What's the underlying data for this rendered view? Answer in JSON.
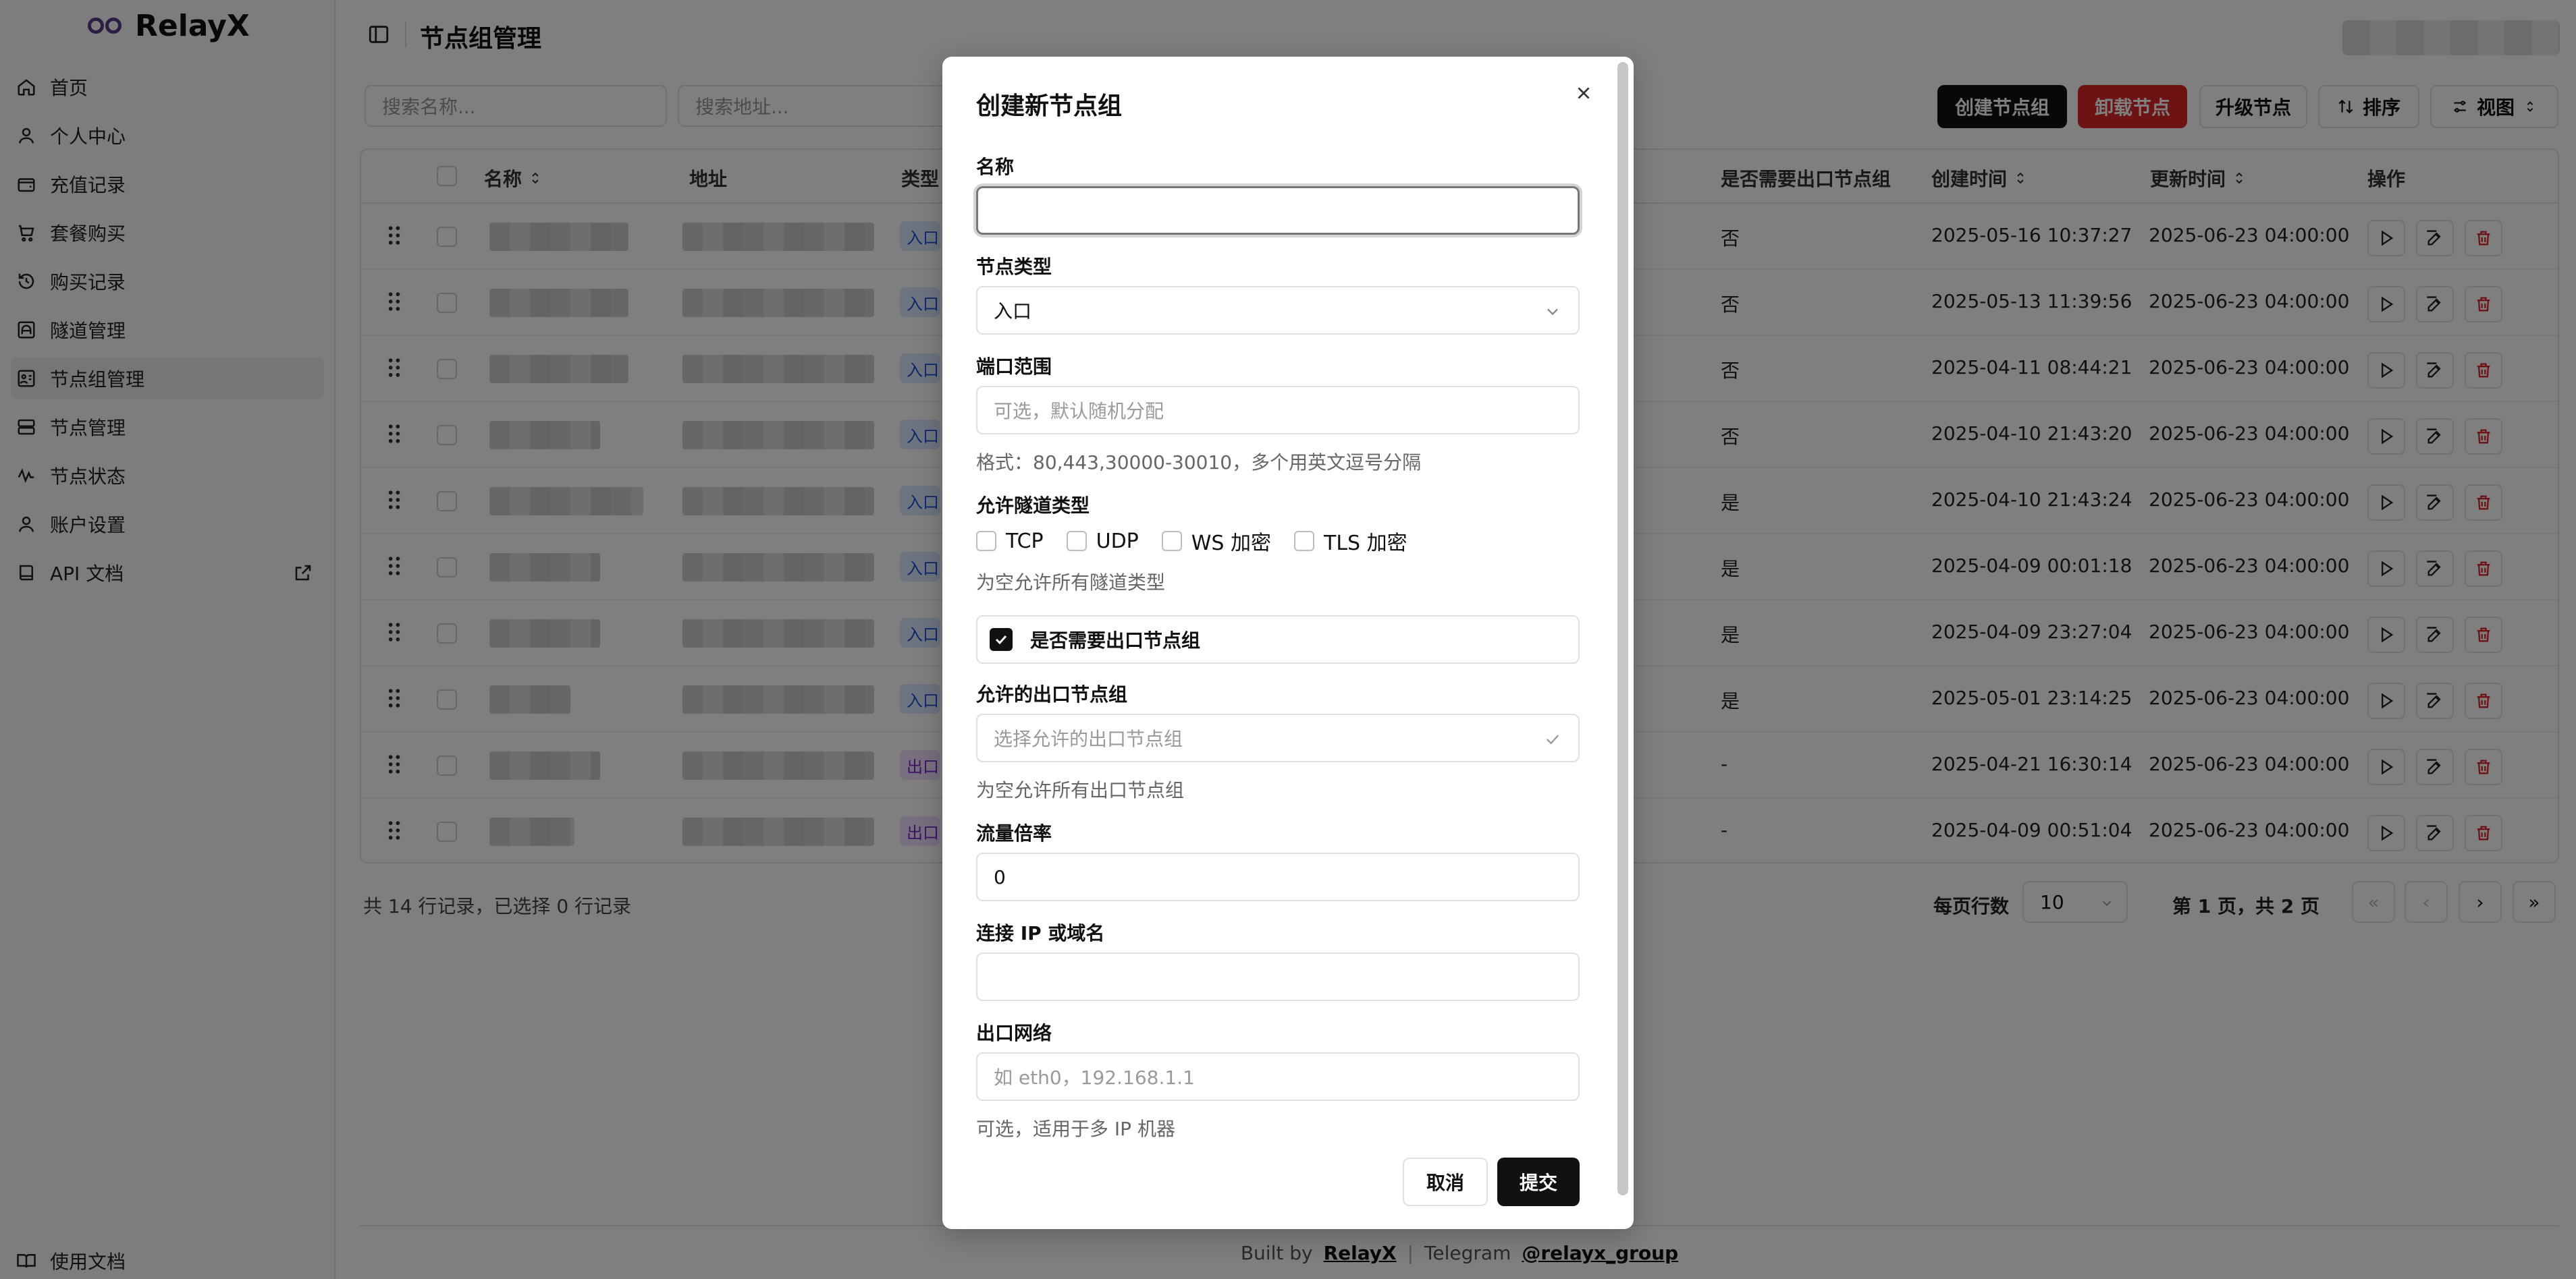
{
  "app": {
    "name": "RelayX"
  },
  "sidebar": {
    "items": [
      {
        "label": "首页",
        "icon": "home-icon"
      },
      {
        "label": "个人中心",
        "icon": "user-icon"
      },
      {
        "label": "充值记录",
        "icon": "wallet-icon"
      },
      {
        "label": "套餐购买",
        "icon": "cart-icon"
      },
      {
        "label": "购买记录",
        "icon": "history-icon"
      },
      {
        "label": "隧道管理",
        "icon": "tunnel-icon"
      },
      {
        "label": "节点组管理",
        "icon": "group-icon",
        "active": true
      },
      {
        "label": "节点管理",
        "icon": "server-icon"
      },
      {
        "label": "节点状态",
        "icon": "activity-icon"
      },
      {
        "label": "账户设置",
        "icon": "user-settings-icon"
      },
      {
        "label": "API 文档",
        "icon": "book-icon",
        "external": true
      }
    ],
    "bottom_item": "使用文档"
  },
  "header": {
    "title": "节点组管理"
  },
  "toolbar": {
    "search_name_placeholder": "搜索名称...",
    "search_address_placeholder": "搜索地址...",
    "create_label": "创建节点组",
    "uninstall_label": "卸载节点",
    "upgrade_label": "升级节点",
    "sort_label": "排序",
    "view_label": "视图"
  },
  "table": {
    "headers": {
      "name": "名称",
      "address": "地址",
      "type": "类型",
      "need_exit": "是否需要出口节点组",
      "created": "创建时间",
      "updated": "更新时间",
      "actions": "操作"
    },
    "rows": [
      {
        "type": "入口",
        "need_exit": "否",
        "created": "2025-05-16 10:37:27",
        "updated": "2025-06-23 04:00:00"
      },
      {
        "type": "入口",
        "need_exit": "否",
        "created": "2025-05-13 11:39:56",
        "updated": "2025-06-23 04:00:00"
      },
      {
        "type": "入口",
        "need_exit": "否",
        "created": "2025-04-11 08:44:21",
        "updated": "2025-06-23 04:00:00"
      },
      {
        "type": "入口",
        "need_exit": "否",
        "created": "2025-04-10 21:43:20",
        "updated": "2025-06-23 04:00:00"
      },
      {
        "type": "入口",
        "need_exit": "是",
        "created": "2025-04-10 21:43:24",
        "updated": "2025-06-23 04:00:00"
      },
      {
        "type": "入口",
        "need_exit": "是",
        "created": "2025-04-09 00:01:18",
        "updated": "2025-06-23 04:00:00"
      },
      {
        "type": "入口",
        "need_exit": "是",
        "created": "2025-04-09 23:27:04",
        "updated": "2025-06-23 04:00:00"
      },
      {
        "type": "入口",
        "need_exit": "是",
        "created": "2025-05-01 23:14:25",
        "updated": "2025-06-23 04:00:00"
      },
      {
        "type": "出口",
        "need_exit": "-",
        "created": "2025-04-21 16:30:14",
        "updated": "2025-06-23 04:00:00"
      },
      {
        "type": "出口",
        "need_exit": "-",
        "created": "2025-04-09 00:51:04",
        "updated": "2025-06-23 04:00:00"
      }
    ]
  },
  "pagination": {
    "summary": "共 14 行记录，已选择 0 行记录",
    "rows_per_page_label": "每页行数",
    "rows_per_page": "10",
    "page_info": "第 1 页，共 2 页"
  },
  "footer": {
    "built_by": "Built by",
    "author": "RelayX",
    "telegram": "Telegram",
    "group": "@relayx_group"
  },
  "modal": {
    "title": "创建新节点组",
    "name_label": "名称",
    "name_value": "",
    "type_label": "节点类型",
    "type_value": "入口",
    "port_label": "端口范围",
    "port_placeholder": "可选，默认随机分配",
    "port_help": "格式：80,443,30000-30010，多个用英文逗号分隔",
    "tunnel_types_label": "允许隧道类型",
    "tunnel_types": [
      {
        "label": "TCP",
        "checked": false
      },
      {
        "label": "UDP",
        "checked": false
      },
      {
        "label": "WS 加密",
        "checked": false
      },
      {
        "label": "TLS 加密",
        "checked": false
      }
    ],
    "tunnel_types_help": "为空允许所有隧道类型",
    "need_exit_label": "是否需要出口节点组",
    "need_exit_checked": true,
    "exit_groups_label": "允许的出口节点组",
    "exit_groups_placeholder": "选择允许的出口节点组",
    "exit_groups_help": "为空允许所有出口节点组",
    "traffic_ratio_label": "流量倍率",
    "traffic_ratio_value": "0",
    "connect_label": "连接 IP 或域名",
    "connect_value": "",
    "egress_label": "出口网络",
    "egress_placeholder": "如 eth0，192.168.1.1",
    "egress_help": "可选，适用于多 IP 机器",
    "cancel_label": "取消",
    "submit_label": "提交"
  },
  "colors": {
    "primary": "#111111",
    "danger": "#dc2626",
    "entry_badge": "#dbe8ff",
    "exit_badge": "#f0e0ff",
    "overlay": "rgba(0,0,0,0.5)"
  }
}
